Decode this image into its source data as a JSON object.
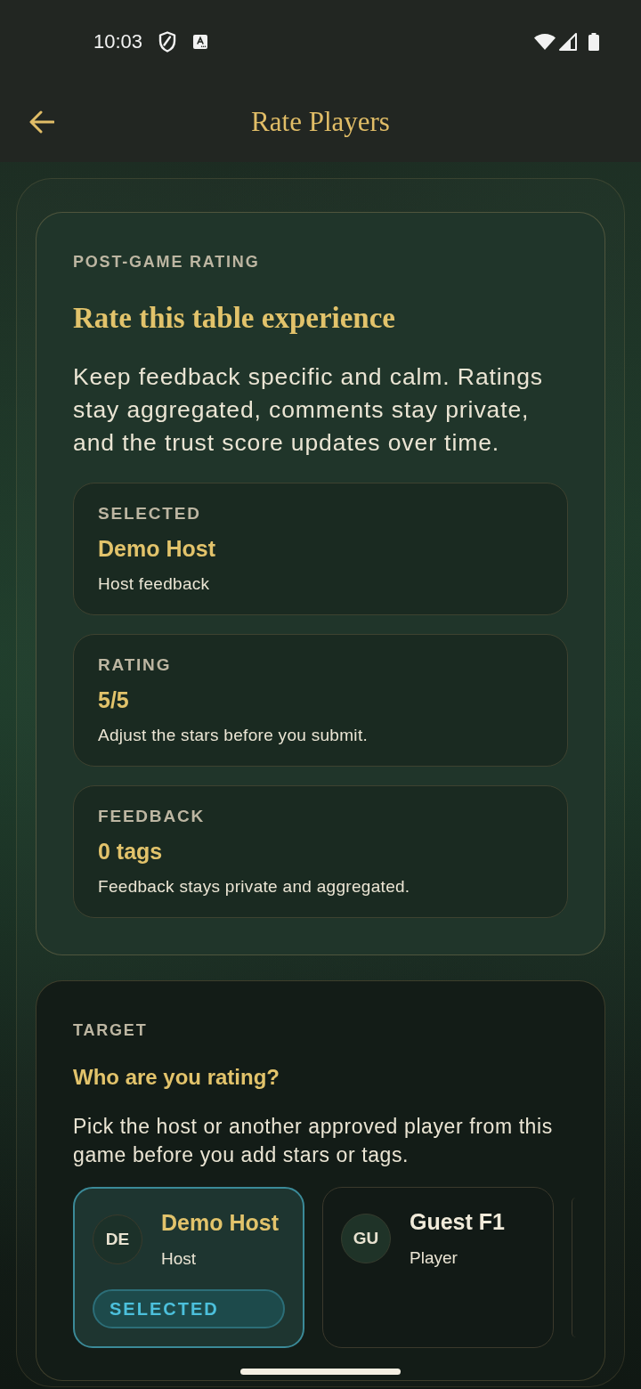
{
  "status_bar": {
    "time": "10:03"
  },
  "top_bar": {
    "title": "Rate Players"
  },
  "summary": {
    "eyebrow": "POST-GAME RATING",
    "title": "Rate this table experience",
    "description": "Keep feedback specific and calm. Ratings stay aggregated, comments stay private, and the trust score updates over time.",
    "stats": [
      {
        "label": "SELECTED",
        "value": "Demo Host",
        "note": "Host feedback"
      },
      {
        "label": "RATING",
        "value": "5/5",
        "note": "Adjust the stars before you submit."
      },
      {
        "label": "FEEDBACK",
        "value": "0 tags",
        "note": "Feedback stays private and aggregated."
      }
    ]
  },
  "target": {
    "eyebrow": "TARGET",
    "title": "Who are you rating?",
    "description": "Pick the host or another approved player from this game before you add stars or tags.",
    "players": [
      {
        "initials": "DE",
        "name": "Demo Host",
        "role": "Host",
        "selected": true,
        "badge": "SELECTED"
      },
      {
        "initials": "GU",
        "name": "Guest F1",
        "role": "Player",
        "selected": false
      }
    ]
  }
}
